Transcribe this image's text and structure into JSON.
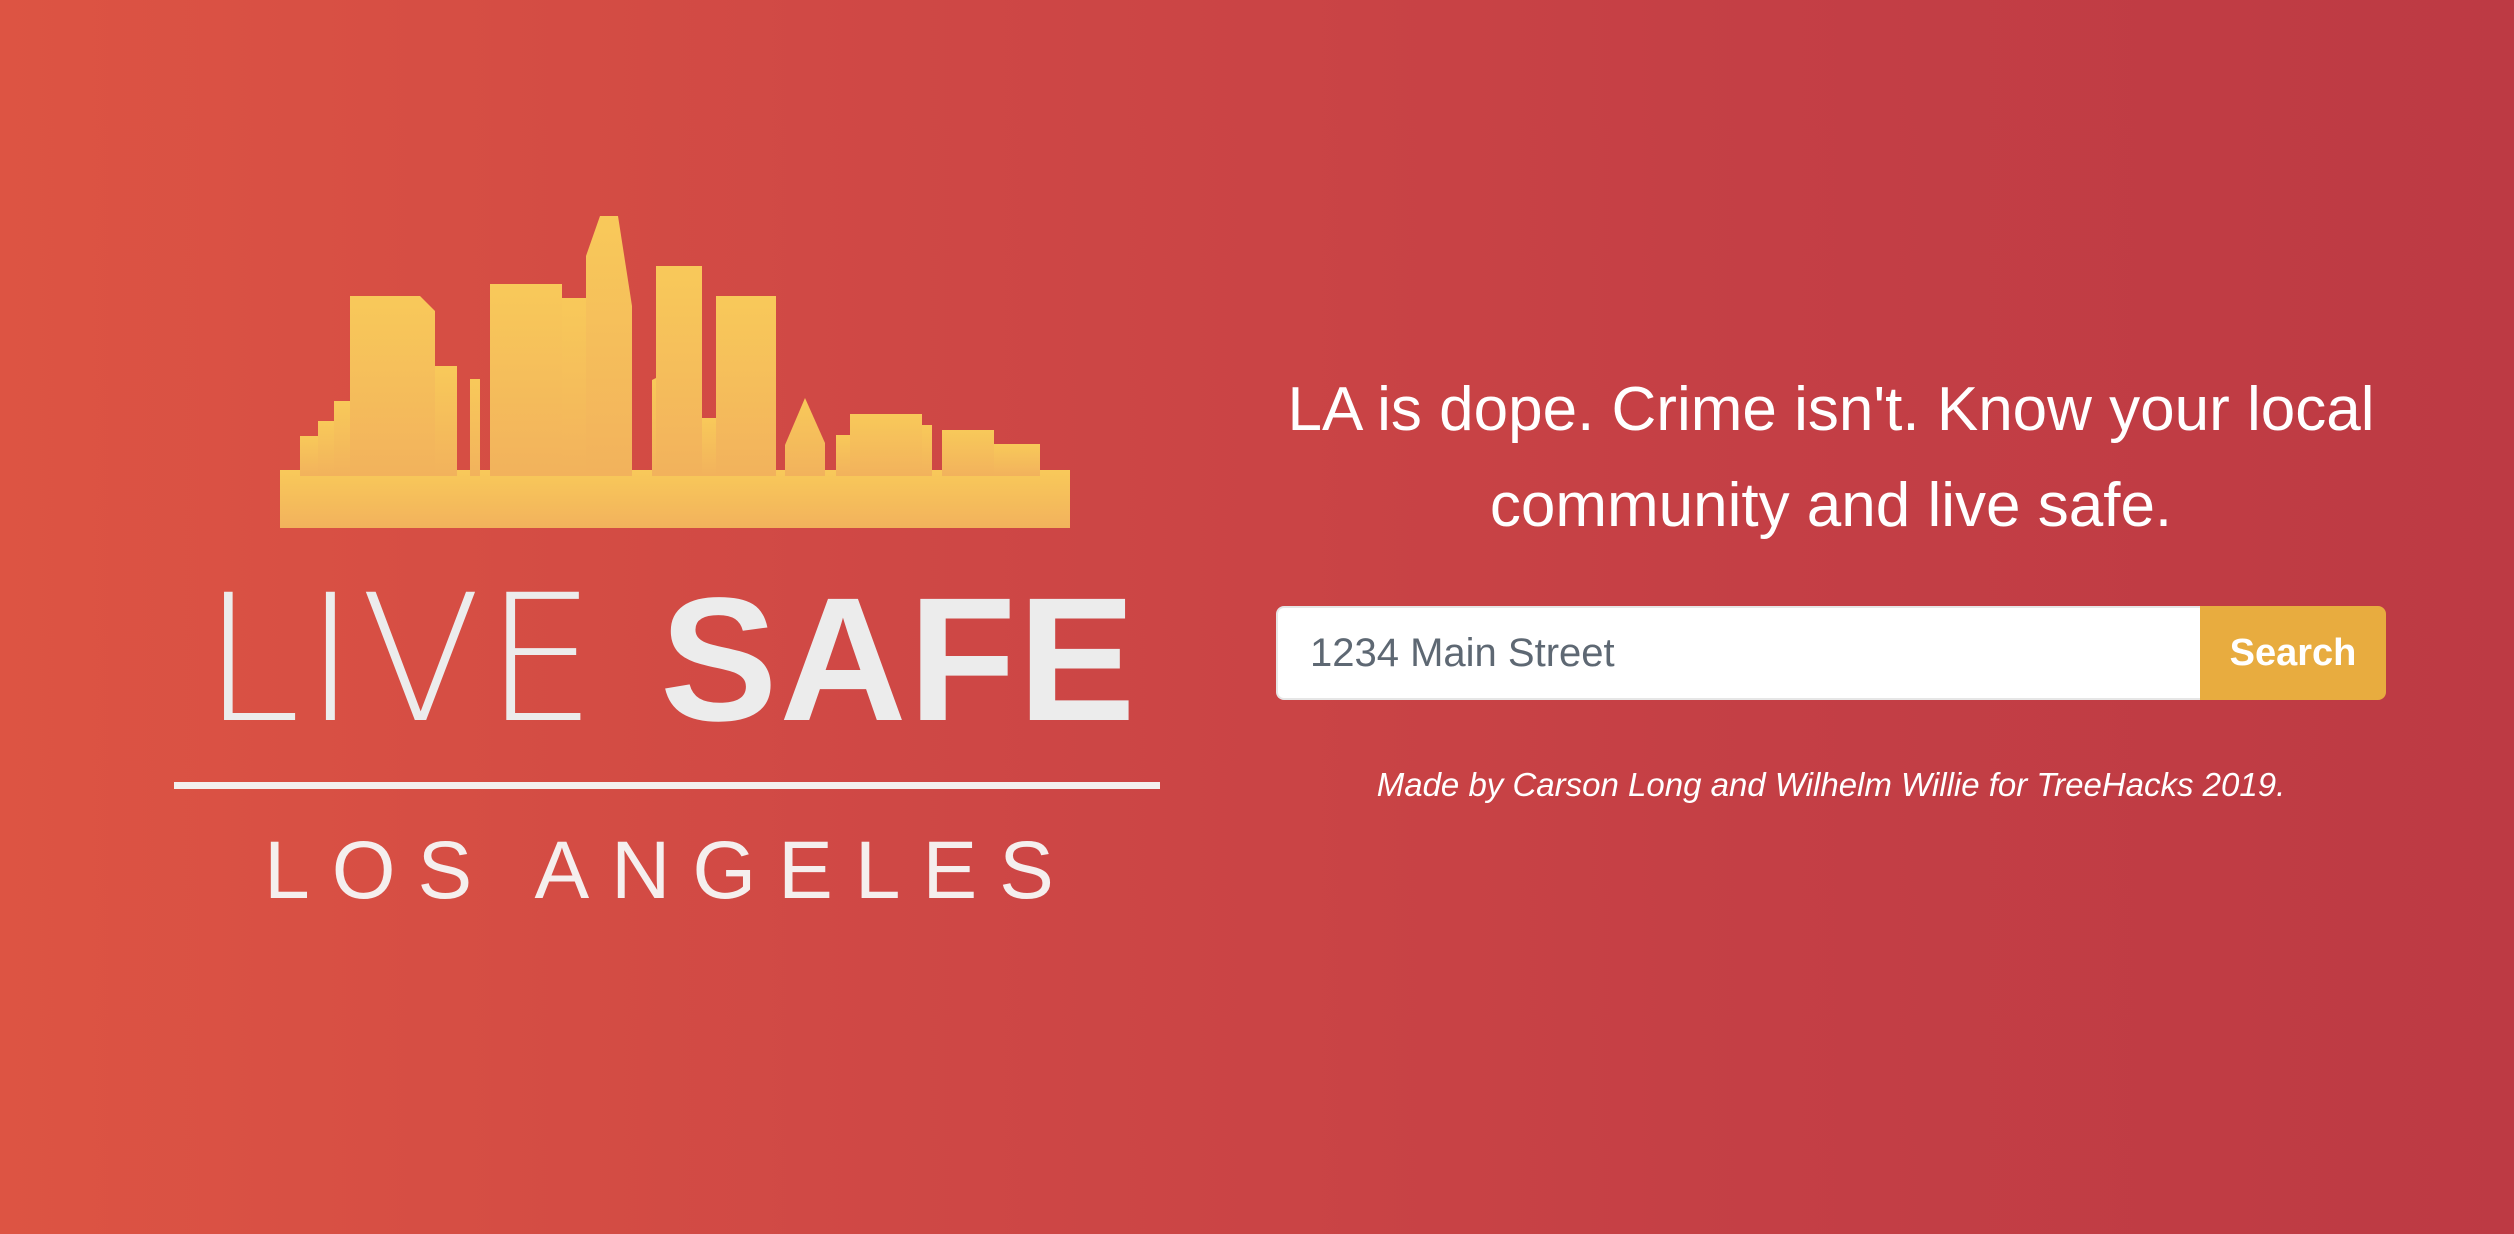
{
  "brand": {
    "title_light": "LIVE",
    "title_bold": "SAFE",
    "city": "LOS ANGELES"
  },
  "hero": {
    "tagline": "LA is dope. Crime isn't. Know your local community and live safe."
  },
  "search": {
    "placeholder": "1234 Main Street",
    "button_label": "Search"
  },
  "footer": {
    "credit": "Made by Carson Long and Wilhelm Willie for TreeHacks 2019."
  },
  "colors": {
    "skyline_top": "#f8c95a",
    "skyline_bottom": "#f2b25c",
    "button": "#e8ac3f",
    "background_left": "#dd5443",
    "background_right": "#bd3a44"
  },
  "icons": {
    "skyline": "los-angeles-skyline-icon"
  }
}
